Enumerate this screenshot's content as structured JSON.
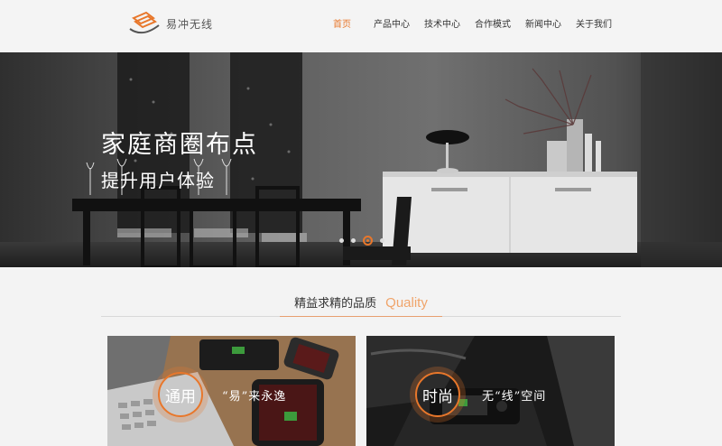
{
  "header": {
    "brand": "易冲无线",
    "nav": [
      {
        "label": "首页",
        "active": true
      },
      {
        "label": "产品中心",
        "active": false
      },
      {
        "label": "技术中心",
        "active": false
      },
      {
        "label": "合作模式",
        "active": false
      },
      {
        "label": "新闻中心",
        "active": false
      },
      {
        "label": "关于我们",
        "active": false
      }
    ]
  },
  "banner": {
    "title": "家庭商圈布点",
    "subtitle": "提升用户体验",
    "slides": 4,
    "active_slide": 3
  },
  "section": {
    "title_cn": "精益求精的品质",
    "title_en": "Quality"
  },
  "cards": [
    {
      "badge": "通用",
      "caption": "“易”来永逸"
    },
    {
      "badge": "时尚",
      "caption": "无“线”空间"
    }
  ],
  "colors": {
    "accent": "#e8772b",
    "header_bg": "#f4f4f4",
    "page_bg": "#f3f3f3"
  }
}
